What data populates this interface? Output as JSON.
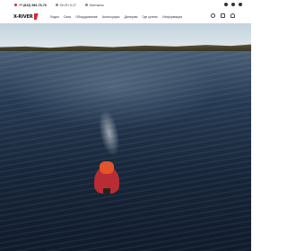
{
  "topbar": {
    "phone": "+7 (812) 981-76-76",
    "hours": "Пн-Пт 9-17",
    "contacts": "Контакты"
  },
  "navbar": {
    "logo": "X-RIVER",
    "menu": [
      "Лодки",
      "Сани",
      "Оборудование",
      "Аксессуары",
      "Дилерам",
      "Где купить",
      "Информация"
    ]
  },
  "icons": [
    "search-icon",
    "favorites-icon",
    "user-icon"
  ],
  "colors": {
    "brand_red": "#d9262c",
    "water": "#17263a"
  }
}
